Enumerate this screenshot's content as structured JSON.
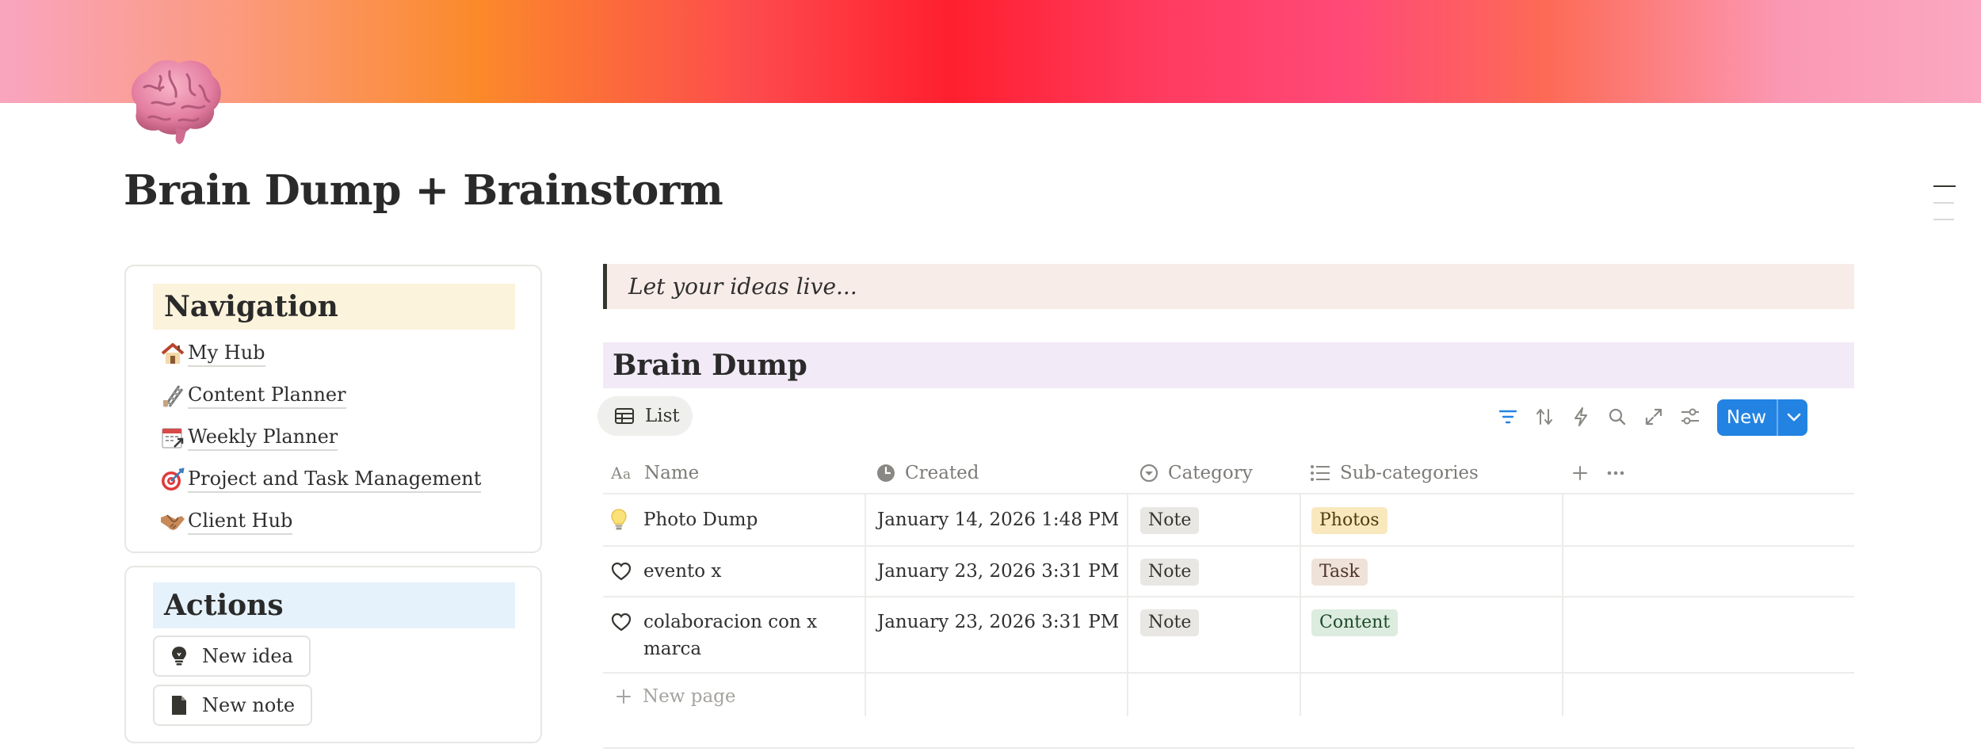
{
  "page": {
    "title": "Brain Dump + Brainstorm",
    "icon": "brain-icon"
  },
  "navigation": {
    "header": "Navigation",
    "items": [
      {
        "icon": "house-icon",
        "label": "My Hub"
      },
      {
        "icon": "ladder-icon",
        "label": "Content Planner"
      },
      {
        "icon": "calendar-link-icon",
        "label": "Weekly Planner"
      },
      {
        "icon": "target-icon",
        "label": "Project and Task Management"
      },
      {
        "icon": "handshake-icon",
        "label": "Client Hub"
      }
    ]
  },
  "actions": {
    "header": "Actions",
    "buttons": [
      {
        "icon": "lightbulb-icon",
        "label": "New idea"
      },
      {
        "icon": "document-icon",
        "label": "New note"
      }
    ]
  },
  "callout": {
    "text": "Let your ideas live..."
  },
  "database": {
    "title": "Brain Dump",
    "view_label": "List",
    "new_label": "New",
    "columns": [
      {
        "icon": "text-type-icon",
        "label": "Name"
      },
      {
        "icon": "clock-icon",
        "label": "Created"
      },
      {
        "icon": "select-icon",
        "label": "Category"
      },
      {
        "icon": "list-icon",
        "label": "Sub-categories"
      }
    ],
    "rows": [
      {
        "icon": "lightbulb-icon",
        "name": "Photo Dump",
        "created": "January 14, 2026 1:48 PM",
        "category": "Note",
        "subcategory": "Photos",
        "sub_color": "#f9e8be"
      },
      {
        "icon": "heart-icon",
        "name": "evento x",
        "created": "January 23, 2026 3:31 PM",
        "category": "Note",
        "subcategory": "Task",
        "sub_color": "#efe2d9"
      },
      {
        "icon": "heart-icon",
        "name": "colaboracion con x marca",
        "created": "January 23, 2026 3:31 PM",
        "category": "Note",
        "subcategory": "Content",
        "sub_color": "#dcecdf"
      }
    ],
    "new_page_label": "New page"
  },
  "colors": {
    "accent": "#2383e2",
    "nav_header_bg": "#fbf3db",
    "actions_header_bg": "#e6f2fb",
    "callout_bg": "#f8ece8",
    "db_title_bg": "#f2eaf6"
  }
}
